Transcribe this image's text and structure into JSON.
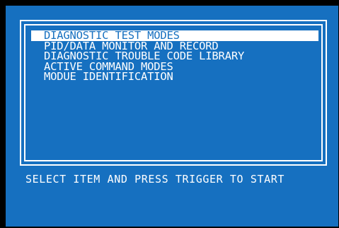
{
  "colors": {
    "background": "#000000",
    "screen": "#1670c0",
    "text": "#ffffff",
    "selection": "#ffffff"
  },
  "menu": {
    "selected_index": 0,
    "items": [
      "DIAGNOSTIC TEST MODES",
      "PID/DATA MONITOR AND RECORD",
      "DIAGNOSTIC TROUBLE CODE LIBRARY",
      "ACTIVE COMMAND MODES",
      "MODUE IDENTIFICATION"
    ]
  },
  "prompt": {
    "text": "SELECT ITEM AND PRESS TRIGGER TO START"
  }
}
